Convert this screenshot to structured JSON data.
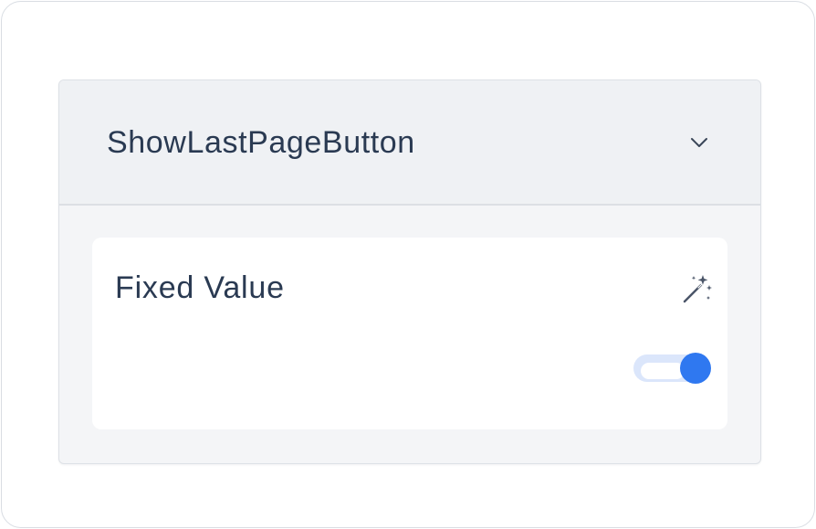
{
  "panel": {
    "title": "ShowLastPageButton",
    "expanded": true,
    "chevron_icon": "chevron-down-icon"
  },
  "field": {
    "label": "Fixed Value",
    "wand_icon": "magic-wand-icon",
    "toggle_on": true,
    "toggle_color": "#2f78f0"
  }
}
